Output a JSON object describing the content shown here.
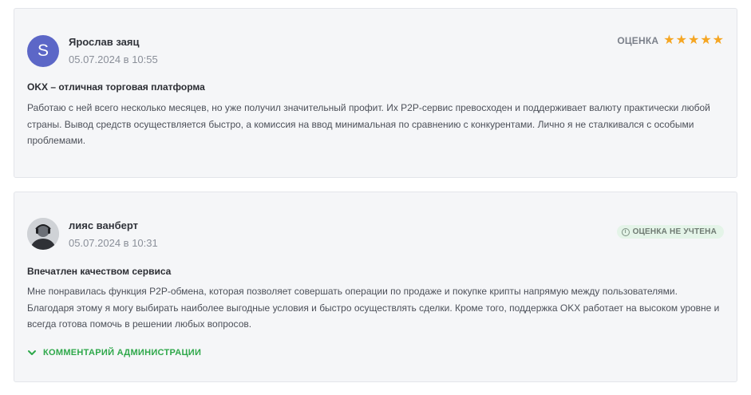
{
  "reviews": [
    {
      "avatar_letter": "S",
      "name": "Ярослав заяц",
      "date": "05.07.2024 в 10:55",
      "rating_label": "ОЦЕНКА",
      "rating_stars": 5,
      "title": "OKX – отличная торговая платформа",
      "text": "Работаю с ней всего несколько месяцев, но уже получил значительный профит. Их P2P-сервис превосходен и поддерживает валюту практически любой страны. Вывод средств осуществляется быстро, а комиссия на ввод минимальная по сравнению с конкурентами. Лично я не сталкивался с особыми проблемами."
    },
    {
      "name": "лияс ванберт",
      "date": "05.07.2024 в 10:31",
      "badge_text": "ОЦЕНКА НЕ УЧТЕНА",
      "title": "Впечатлен качеством сервиса",
      "text": "Мне понравилась функция P2P-обмена, которая позволяет совершать операции по продаже и покупке крипты напрямую между пользователями. Благодаря этому я могу выбирать наиболее выгодные условия и быстро осуществлять сделки. Кроме того, поддержка OKX работает на высоком уровне и всегда готова помочь в решении любых вопросов.",
      "admin_comment_label": "КОММЕНТАРИЙ АДМИНИСТРАЦИИ"
    }
  ],
  "colors": {
    "star": "#f5a623",
    "avatar_bg": "#5c67c7",
    "admin_green": "#2ea84a",
    "badge_bg": "#e4f4e8"
  }
}
